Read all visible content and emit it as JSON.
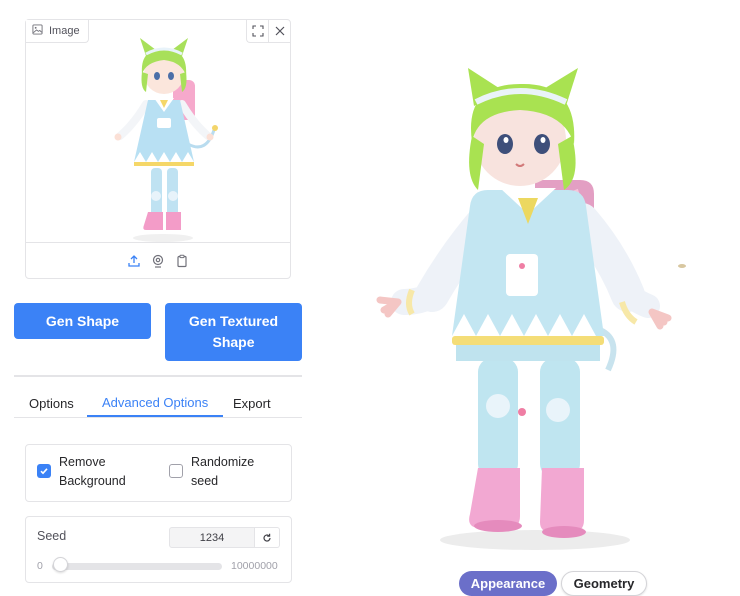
{
  "image_panel": {
    "label": "Image",
    "label_icon": "image-icon",
    "actions": [
      "fullscreen-icon",
      "close-icon"
    ],
    "footer_icons": [
      "upload-icon",
      "webcam-icon",
      "clipboard-icon"
    ]
  },
  "buttons": {
    "gen_shape": "Gen Shape",
    "gen_textured": "Gen Textured Shape"
  },
  "tabs": [
    {
      "label": "Options",
      "active": false
    },
    {
      "label": "Advanced Options",
      "active": true
    },
    {
      "label": "Export",
      "active": false
    }
  ],
  "advanced": {
    "remove_background": {
      "label": "Remove Background",
      "checked": true
    },
    "randomize_seed": {
      "label": "Randomize seed",
      "checked": false
    },
    "seed": {
      "label": "Seed",
      "value": "1234",
      "reset_icon": "reset-icon",
      "min": "0",
      "max": "10000000",
      "current_fraction": 0.0001234
    }
  },
  "viewer": {
    "modes": [
      {
        "label": "Appearance",
        "active": true
      },
      {
        "label": "Geometry",
        "active": false
      }
    ]
  },
  "colors": {
    "primary": "#3b82f6",
    "appearance_active": "#6b6fc9",
    "border": "#e4e4e7"
  }
}
